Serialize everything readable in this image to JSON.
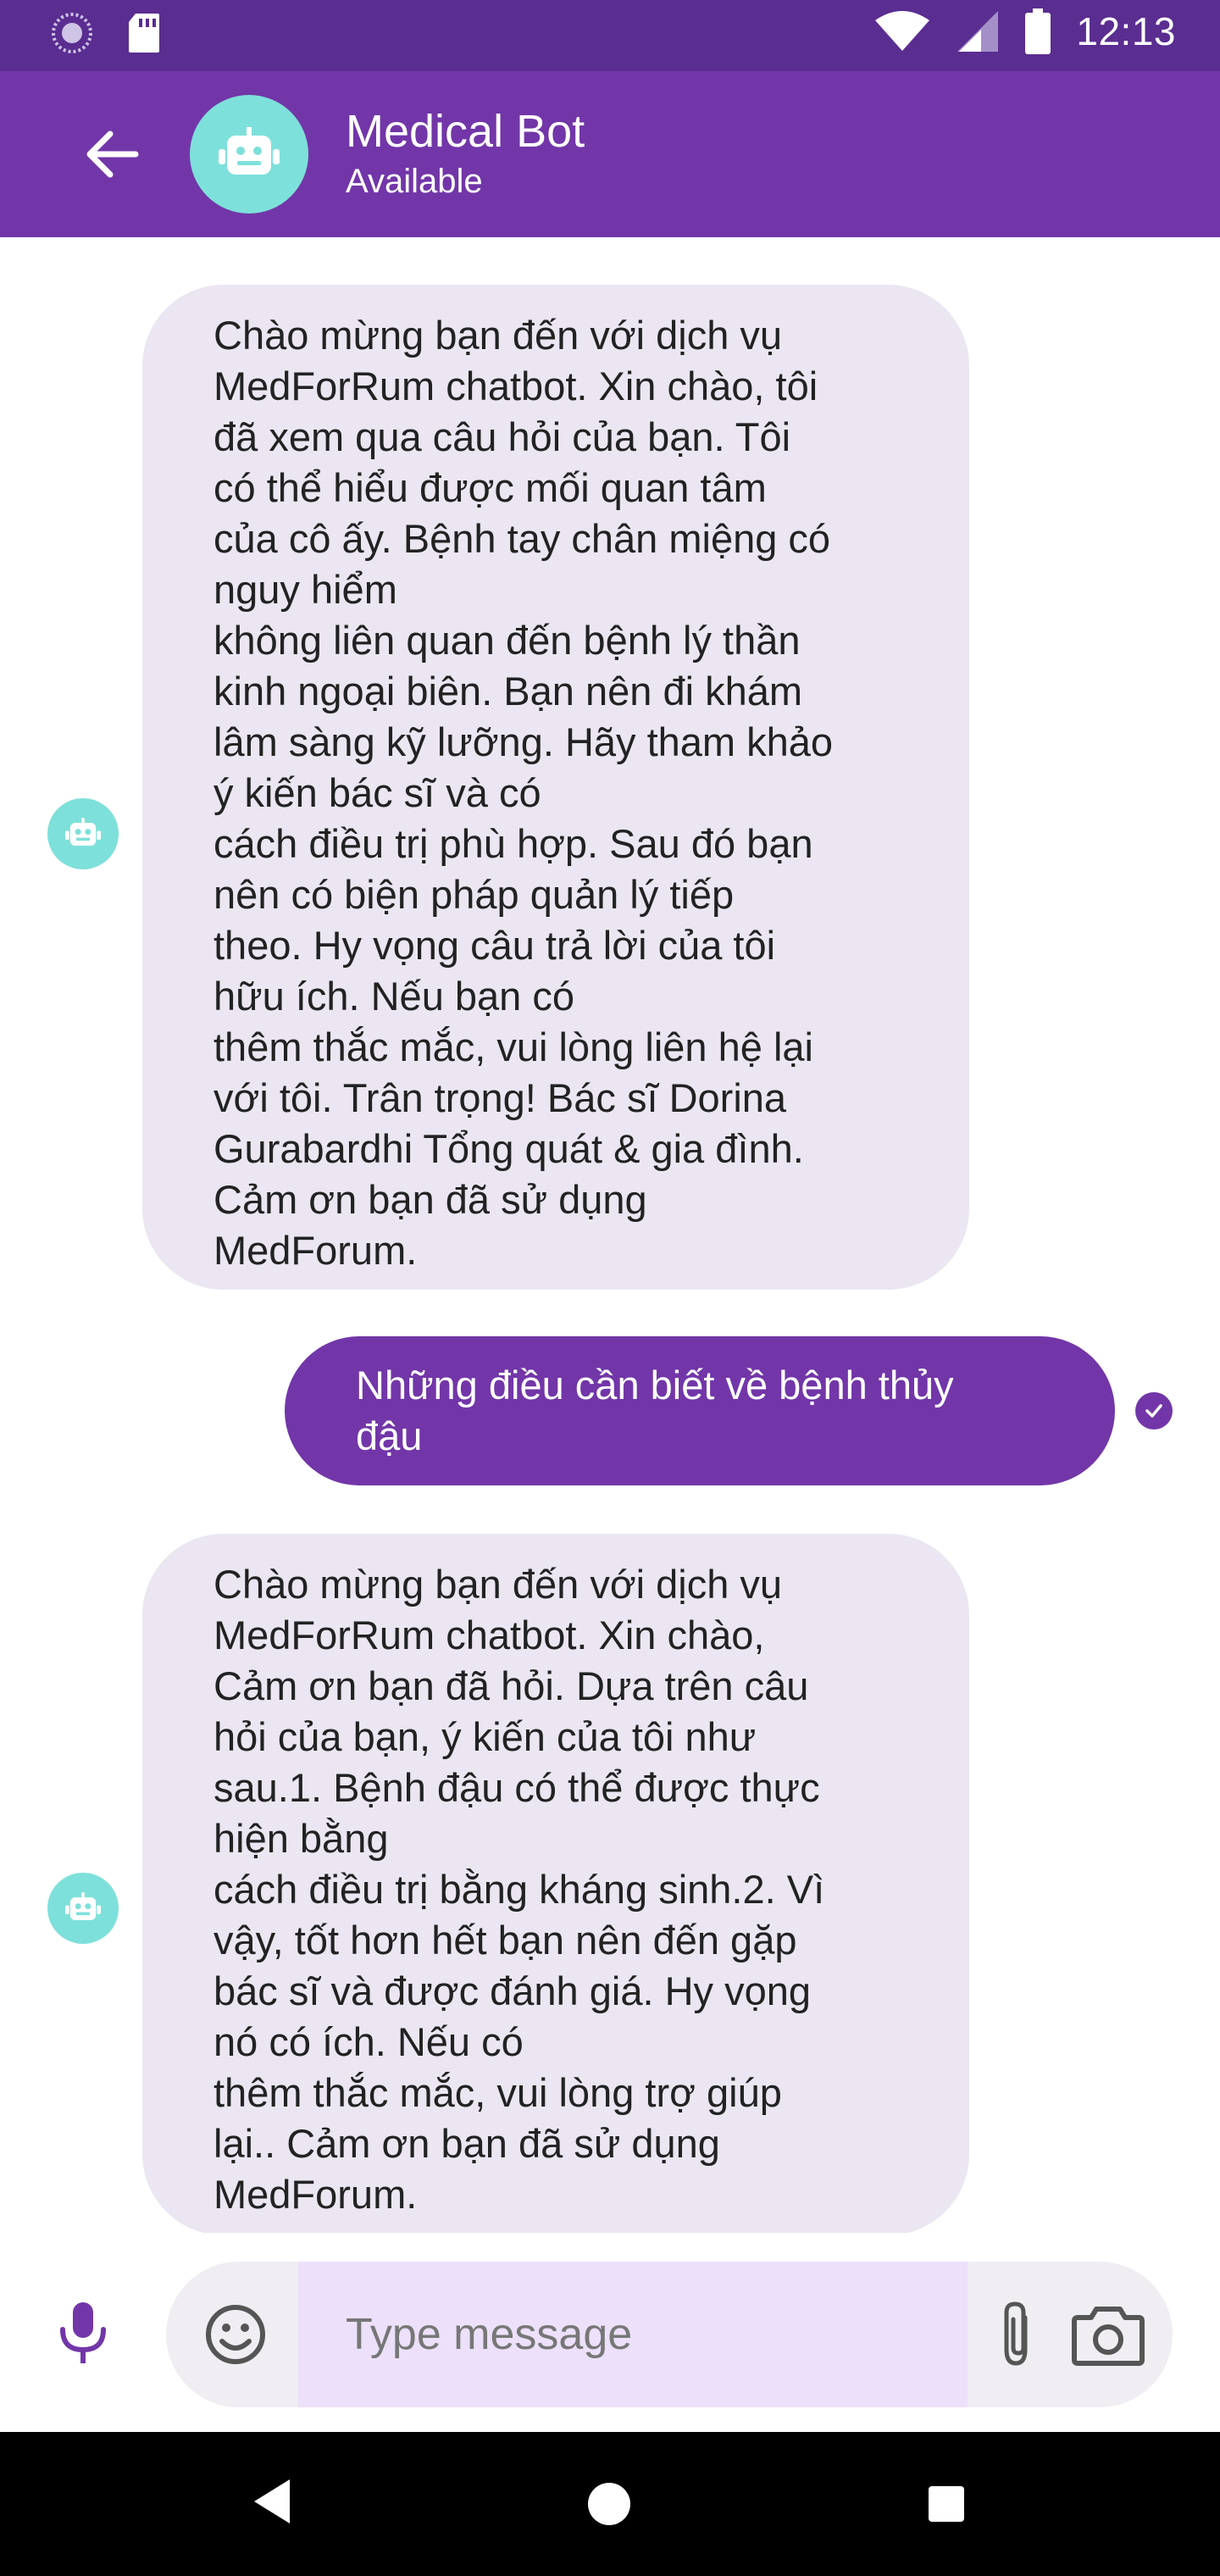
{
  "status_bar": {
    "time": "12:13",
    "icons": [
      "loading-circle-icon",
      "sd-card-icon",
      "wifi-icon",
      "signal-icon",
      "battery-icon"
    ]
  },
  "header": {
    "title": "Medical Bot",
    "subtitle": "Available",
    "back_icon": "arrow-left-icon",
    "avatar_icon": "robot-icon"
  },
  "colors": {
    "status_bar": "#5a2d91",
    "app_bar": "#7236a8",
    "avatar_bg": "#7ee0da",
    "bot_bubble": "#ebe6f2",
    "user_bubble": "#7236a8",
    "input_field": "#ece0fb"
  },
  "messages": [
    {
      "sender": "bot",
      "text": "Chào mừng bạn đến với dịch vụ\nMedForRum chatbot. Xin chào, tôi\nđã xem qua câu hỏi của bạn. Tôi\ncó thể hiểu được mối quan tâm\ncủa cô ấy. Bệnh tay chân miệng có\nnguy hiểm\nkhông liên quan đến bệnh lý thần\nkinh ngoại biên. Bạn nên đi khám\nlâm sàng kỹ lưỡng. Hãy tham khảo\ný kiến bác sĩ và có\ncách điều trị phù hợp. Sau đó bạn\nnên có biện pháp quản lý tiếp\ntheo. Hy vọng câu trả lời của tôi\nhữu ích. Nếu bạn có\nthêm thắc mắc, vui lòng liên hệ lại\nvới tôi. Trân trọng! Bác sĩ Dorina\nGurabardhi Tổng quát & gia đình.\nCảm ơn bạn đã sử dụng\nMedForum."
    },
    {
      "sender": "user",
      "text": "Những điều cần biết về bệnh thủy\nđậu",
      "status_icon": "check-circle-icon"
    },
    {
      "sender": "bot",
      "text": "Chào mừng bạn đến với dịch vụ\nMedForRum chatbot. Xin chào,\nCảm ơn bạn đã hỏi. Dựa trên câu\nhỏi của bạn, ý kiến của tôi như\nsau.1. Bệnh đậu có thể được thực\nhiện bằng\ncách điều trị bằng kháng sinh.2. Vì\nvậy, tốt hơn hết bạn nên đến gặp\nbác sĩ và được đánh giá. Hy vọng\nnó có ích. Nếu có\nthêm thắc mắc, vui lòng trợ giúp\nlại.. Cảm ơn bạn đã sử dụng\nMedForum."
    }
  ],
  "composer": {
    "placeholder": "Type message",
    "value": "",
    "icons": [
      "microphone-icon",
      "emoji-icon",
      "paperclip-icon",
      "camera-icon"
    ]
  },
  "nav_bar": {
    "icons": [
      "nav-back-icon",
      "nav-home-icon",
      "nav-recents-icon"
    ]
  }
}
